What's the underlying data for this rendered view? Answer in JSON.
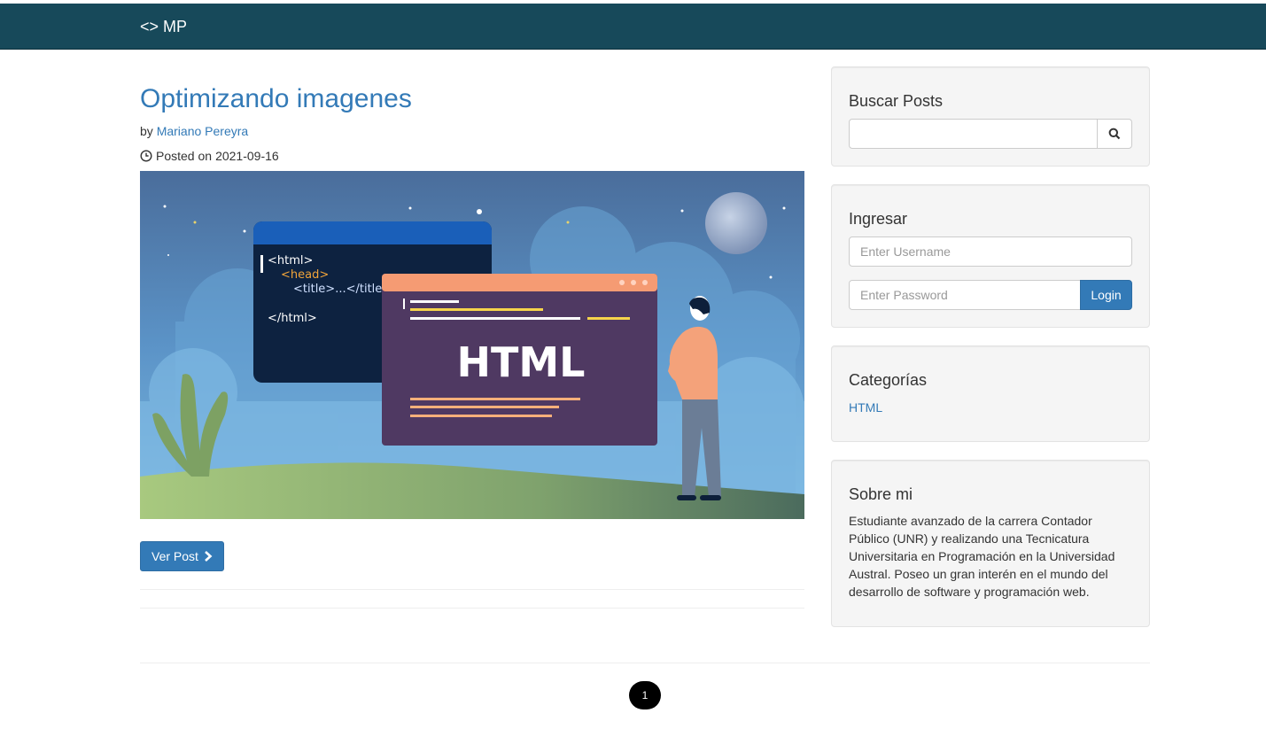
{
  "navbar": {
    "brand": "<> MP"
  },
  "post": {
    "title": "Optimizando imagenes",
    "by_prefix": "by",
    "author": "Mariano Pereyra",
    "posted_prefix": "Posted on",
    "posted_date": "2021-09-16",
    "image": {
      "alt": "HTML illustration",
      "code_lines": [
        "<html>",
        "<head>",
        "<title>...</title>",
        "</html>"
      ],
      "window_label": "HTML"
    },
    "button_label": "Ver Post"
  },
  "sidebar": {
    "search": {
      "title": "Buscar Posts",
      "placeholder": ""
    },
    "login": {
      "title": "Ingresar",
      "username_placeholder": "Enter Username",
      "password_placeholder": "Enter Password",
      "button_label": "Login"
    },
    "categories": {
      "title": "Categorías",
      "items": [
        "HTML"
      ]
    },
    "about": {
      "title": "Sobre mi",
      "text": "Estudiante avanzado de la carrera Contador Público (UNR) y realizando una Tecnicatura Universitaria en Programación en la Universidad Austral. Poseo un gran interén en el mundo del desarrollo de software y programación web."
    }
  },
  "pagination": {
    "current": "1"
  },
  "colors": {
    "navbar": "#17495a",
    "primary": "#337ab7",
    "link": "#337ab7"
  }
}
